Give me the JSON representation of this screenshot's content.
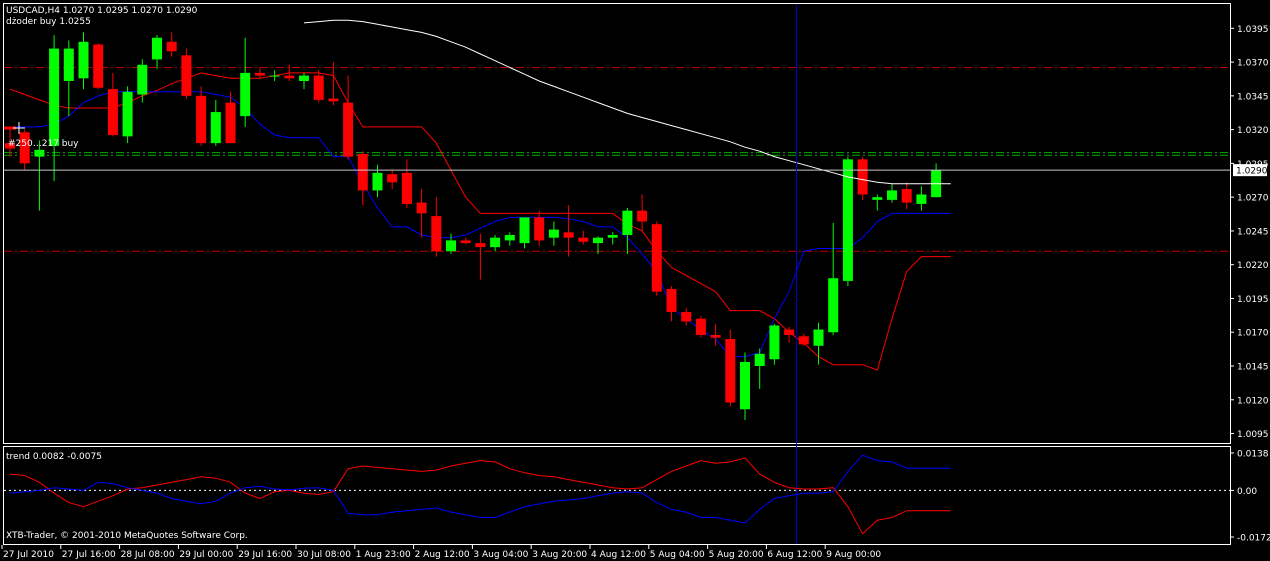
{
  "header": {
    "symbol_line": "USDCAD,H4 1.0270 1.0295 1.0270 1.0290",
    "order_line": "dżoder buy 1.0255",
    "trade_label": "#250…217 buy"
  },
  "indicator": {
    "title": "trend 0.0082 -0.0075",
    "scale_labels": [
      "0.0138",
      "0.00",
      "-0.0172"
    ],
    "levels": [
      0.0138,
      0.0,
      -0.0172
    ]
  },
  "copyright": "XTB-Trader, © 2001-2010 MetaQuotes Software Corp.",
  "colors": {
    "background": "#000000",
    "frame": "#ffffff",
    "bull": "#00ff00",
    "bear": "#ff0000",
    "red_line": "#ff0000",
    "blue_line": "#0000ff",
    "ma_line": "#ffffff",
    "green_level": "#00b000",
    "red_level": "#c00000",
    "vertical_line": "#0000cc"
  },
  "chart_data": {
    "type": "candlestick",
    "symbol": "USDCAD",
    "timeframe": "H4",
    "price_axis": {
      "ylim": [
        1.0088,
        1.0413
      ],
      "tick_labels": [
        "1.0395",
        "1.0370",
        "1.0345",
        "1.0320",
        "1.0295",
        "1.0270",
        "1.0245",
        "1.0220",
        "1.0195",
        "1.0170",
        "1.0145",
        "1.0120",
        "1.0095"
      ],
      "tick_values": [
        1.0395,
        1.037,
        1.0345,
        1.032,
        1.0295,
        1.027,
        1.0245,
        1.022,
        1.0195,
        1.017,
        1.0145,
        1.012,
        1.0095
      ],
      "current_price_label": "1.0290",
      "current_price": 1.029
    },
    "time_axis": {
      "labels": [
        "27 Jul 2010",
        "27 Jul 16:00",
        "28 Jul 08:00",
        "29 Jul 00:00",
        "29 Jul 16:00",
        "30 Jul 08:00",
        "1 Aug 23:00",
        "2 Aug 12:00",
        "3 Aug 04:00",
        "3 Aug 20:00",
        "4 Aug 12:00",
        "5 Aug 04:00",
        "5 Aug 20:00",
        "6 Aug 12:00",
        "9 Aug 00:00"
      ],
      "label_bar_index": [
        0,
        4,
        8,
        12,
        16,
        20,
        24,
        28,
        32,
        36,
        40,
        44,
        48,
        52,
        56
      ]
    },
    "horizontal_levels": [
      {
        "price": 1.0366,
        "color": "#c00000"
      },
      {
        "price": 1.0303,
        "color": "#00b000"
      },
      {
        "price": 1.0301,
        "color": "#00b000"
      },
      {
        "price": 1.023,
        "color": "#c00000"
      }
    ],
    "vertical_line_bar": 53.5,
    "candles": [
      {
        "o": 1.031,
        "h": 1.0322,
        "l": 1.03,
        "c": 1.0306
      },
      {
        "o": 1.0318,
        "h": 1.032,
        "l": 1.029,
        "c": 1.0295
      },
      {
        "o": 1.03,
        "h": 1.0312,
        "l": 1.026,
        "c": 1.0305
      },
      {
        "o": 1.0308,
        "h": 1.039,
        "l": 1.0282,
        "c": 1.038
      },
      {
        "o": 1.0356,
        "h": 1.0386,
        "l": 1.033,
        "c": 1.038
      },
      {
        "o": 1.0358,
        "h": 1.0392,
        "l": 1.035,
        "c": 1.0385
      },
      {
        "o": 1.0383,
        "h": 1.0384,
        "l": 1.035,
        "c": 1.0351
      },
      {
        "o": 1.035,
        "h": 1.0362,
        "l": 1.0315,
        "c": 1.0316
      },
      {
        "o": 1.0315,
        "h": 1.0352,
        "l": 1.031,
        "c": 1.0348
      },
      {
        "o": 1.0346,
        "h": 1.0372,
        "l": 1.034,
        "c": 1.0368
      },
      {
        "o": 1.0372,
        "h": 1.039,
        "l": 1.0365,
        "c": 1.0388
      },
      {
        "o": 1.0385,
        "h": 1.0392,
        "l": 1.0374,
        "c": 1.0378
      },
      {
        "o": 1.0375,
        "h": 1.038,
        "l": 1.0343,
        "c": 1.0345
      },
      {
        "o": 1.0345,
        "h": 1.0352,
        "l": 1.0308,
        "c": 1.031
      },
      {
        "o": 1.031,
        "h": 1.0342,
        "l": 1.0308,
        "c": 1.0333
      },
      {
        "o": 1.034,
        "h": 1.0348,
        "l": 1.031,
        "c": 1.031
      },
      {
        "o": 1.033,
        "h": 1.0388,
        "l": 1.0322,
        "c": 1.0362
      },
      {
        "o": 1.0362,
        "h": 1.0366,
        "l": 1.0358,
        "c": 1.036
      },
      {
        "o": 1.036,
        "h": 1.0364,
        "l": 1.0356,
        "c": 1.036
      },
      {
        "o": 1.036,
        "h": 1.0368,
        "l": 1.0356,
        "c": 1.0358
      },
      {
        "o": 1.0356,
        "h": 1.0362,
        "l": 1.035,
        "c": 1.036
      },
      {
        "o": 1.036,
        "h": 1.0364,
        "l": 1.034,
        "c": 1.0342
      },
      {
        "o": 1.0343,
        "h": 1.037,
        "l": 1.0338,
        "c": 1.0341
      },
      {
        "o": 1.034,
        "h": 1.036,
        "l": 1.0298,
        "c": 1.03
      },
      {
        "o": 1.0302,
        "h": 1.0304,
        "l": 1.0264,
        "c": 1.0275
      },
      {
        "o": 1.0275,
        "h": 1.0294,
        "l": 1.027,
        "c": 1.0288
      },
      {
        "o": 1.0287,
        "h": 1.029,
        "l": 1.0276,
        "c": 1.0281
      },
      {
        "o": 1.0288,
        "h": 1.0298,
        "l": 1.0262,
        "c": 1.0265
      },
      {
        "o": 1.0266,
        "h": 1.0276,
        "l": 1.024,
        "c": 1.0258
      },
      {
        "o": 1.0256,
        "h": 1.027,
        "l": 1.0226,
        "c": 1.023
      },
      {
        "o": 1.023,
        "h": 1.0243,
        "l": 1.0228,
        "c": 1.0238
      },
      {
        "o": 1.0238,
        "h": 1.024,
        "l": 1.0235,
        "c": 1.0236
      },
      {
        "o": 1.0236,
        "h": 1.0243,
        "l": 1.0209,
        "c": 1.0233
      },
      {
        "o": 1.0233,
        "h": 1.0242,
        "l": 1.023,
        "c": 1.024
      },
      {
        "o": 1.0238,
        "h": 1.0244,
        "l": 1.0234,
        "c": 1.0242
      },
      {
        "o": 1.0236,
        "h": 1.0255,
        "l": 1.0232,
        "c": 1.0255
      },
      {
        "o": 1.0255,
        "h": 1.026,
        "l": 1.0234,
        "c": 1.0238
      },
      {
        "o": 1.024,
        "h": 1.0252,
        "l": 1.0234,
        "c": 1.0246
      },
      {
        "o": 1.0244,
        "h": 1.0264,
        "l": 1.0226,
        "c": 1.024
      },
      {
        "o": 1.024,
        "h": 1.0245,
        "l": 1.0235,
        "c": 1.0237
      },
      {
        "o": 1.0236,
        "h": 1.0241,
        "l": 1.0228,
        "c": 1.024
      },
      {
        "o": 1.024,
        "h": 1.0244,
        "l": 1.0235,
        "c": 1.0242
      },
      {
        "o": 1.0242,
        "h": 1.0262,
        "l": 1.0228,
        "c": 1.026
      },
      {
        "o": 1.026,
        "h": 1.0272,
        "l": 1.0245,
        "c": 1.0252
      },
      {
        "o": 1.025,
        "h": 1.0252,
        "l": 1.0197,
        "c": 1.02
      },
      {
        "o": 1.0202,
        "h": 1.0204,
        "l": 1.0178,
        "c": 1.0185
      },
      {
        "o": 1.0185,
        "h": 1.0188,
        "l": 1.0175,
        "c": 1.0178
      },
      {
        "o": 1.018,
        "h": 1.0182,
        "l": 1.0166,
        "c": 1.0168
      },
      {
        "o": 1.0168,
        "h": 1.0176,
        "l": 1.016,
        "c": 1.0166
      },
      {
        "o": 1.0165,
        "h": 1.0172,
        "l": 1.0115,
        "c": 1.0118
      },
      {
        "o": 1.0113,
        "h": 1.0155,
        "l": 1.0105,
        "c": 1.0148
      },
      {
        "o": 1.0145,
        "h": 1.0158,
        "l": 1.0128,
        "c": 1.0154
      },
      {
        "o": 1.015,
        "h": 1.0176,
        "l": 1.0146,
        "c": 1.0175
      },
      {
        "o": 1.0172,
        "h": 1.0174,
        "l": 1.0162,
        "c": 1.0168
      },
      {
        "o": 1.0167,
        "h": 1.0169,
        "l": 1.016,
        "c": 1.0161
      },
      {
        "o": 1.016,
        "h": 1.0177,
        "l": 1.0146,
        "c": 1.0172
      },
      {
        "o": 1.017,
        "h": 1.0251,
        "l": 1.0168,
        "c": 1.021
      },
      {
        "o": 1.0208,
        "h": 1.03,
        "l": 1.0204,
        "c": 1.0298
      },
      {
        "o": 1.0298,
        "h": 1.03,
        "l": 1.0268,
        "c": 1.0272
      },
      {
        "o": 1.0268,
        "h": 1.0272,
        "l": 1.026,
        "c": 1.027
      },
      {
        "o": 1.0268,
        "h": 1.028,
        "l": 1.0266,
        "c": 1.0275
      },
      {
        "o": 1.0276,
        "h": 1.0281,
        "l": 1.0261,
        "c": 1.0266
      },
      {
        "o": 1.0265,
        "h": 1.0278,
        "l": 1.026,
        "c": 1.0272
      },
      {
        "o": 1.027,
        "h": 1.0295,
        "l": 1.027,
        "c": 1.029
      }
    ],
    "envelope_upper": [
      1.035,
      1.0346,
      1.0342,
      1.0338,
      1.0336,
      1.0336,
      1.0336,
      1.0336,
      1.034,
      1.0345,
      1.0349,
      1.0354,
      1.0358,
      1.0362,
      1.036,
      1.0358,
      1.0358,
      1.0358,
      1.036,
      1.0362,
      1.0362,
      1.0362,
      1.036,
      1.034,
      1.0322,
      1.0322,
      1.0322,
      1.0322,
      1.0322,
      1.031,
      1.029,
      1.027,
      1.0258,
      1.0258,
      1.0258,
      1.0258,
      1.0258,
      1.0258,
      1.0258,
      1.0258,
      1.0258,
      1.0258,
      1.025,
      1.0245,
      1.023,
      1.0218,
      1.0212,
      1.0206,
      1.02,
      1.0186,
      1.0186,
      1.0186,
      1.018,
      1.017,
      1.0162,
      1.0152,
      1.0146,
      1.0146,
      1.0146,
      1.0142,
      1.018,
      1.0215,
      1.0226,
      1.0226,
      1.0226
    ],
    "envelope_lower": [
      1.0322,
      1.0322,
      1.0322,
      1.0324,
      1.033,
      1.034,
      1.0345,
      1.0348,
      1.0348,
      1.0348,
      1.0348,
      1.0348,
      1.0348,
      1.0348,
      1.0346,
      1.0344,
      1.0336,
      1.0324,
      1.0316,
      1.0314,
      1.0314,
      1.0314,
      1.03,
      1.03,
      1.028,
      1.0262,
      1.0248,
      1.0248,
      1.0242,
      1.024,
      1.024,
      1.0242,
      1.0247,
      1.0252,
      1.0255,
      1.0255,
      1.0255,
      1.0255,
      1.0254,
      1.0252,
      1.0248,
      1.0248,
      1.024,
      1.0228,
      1.0215,
      1.0188,
      1.018,
      1.0172,
      1.0165,
      1.0152,
      1.0152,
      1.0155,
      1.018,
      1.02,
      1.023,
      1.0232,
      1.0232,
      1.0232,
      1.024,
      1.0252,
      1.0258,
      1.0258,
      1.0258,
      1.0258,
      1.0258
    ],
    "moving_average": [
      1.0399,
      1.04,
      1.0401,
      1.0401,
      1.04,
      1.0398,
      1.0396,
      1.0394,
      1.0392,
      1.0389,
      1.0385,
      1.0381,
      1.0376,
      1.0371,
      1.0366,
      1.0361,
      1.0356,
      1.0352,
      1.0348,
      1.0344,
      1.034,
      1.0336,
      1.0332,
      1.0329,
      1.0326,
      1.0323,
      1.032,
      1.0317,
      1.0314,
      1.0311,
      1.0307,
      1.0304,
      1.03,
      1.0297,
      1.0294,
      1.0291,
      1.0288,
      1.0285,
      1.0283,
      1.0281,
      1.028,
      1.028,
      1.028,
      1.028,
      1.028
    ],
    "moving_average_start_bar": 20,
    "trend_red": [
      0.006,
      0.0055,
      0.003,
      -0.001,
      -0.0045,
      -0.006,
      -0.004,
      -0.002,
      0.0005,
      0.001,
      0.002,
      0.003,
      0.004,
      0.005,
      0.0045,
      0.003,
      -0.001,
      -0.003,
      -0.0005,
      0.0,
      -0.001,
      -0.0015,
      -0.0005,
      0.008,
      0.009,
      0.0085,
      0.008,
      0.0075,
      0.007,
      0.0075,
      0.009,
      0.01,
      0.011,
      0.0105,
      0.008,
      0.0065,
      0.0055,
      0.005,
      0.004,
      0.003,
      0.002,
      0.001,
      0.0005,
      0.001,
      0.004,
      0.007,
      0.009,
      0.011,
      0.01,
      0.0105,
      0.012,
      0.006,
      0.003,
      0.001,
      0.0005,
      0.0005,
      0.001,
      -0.006,
      -0.016,
      -0.011,
      -0.01,
      -0.0075,
      -0.0075,
      -0.0075,
      -0.0075
    ],
    "trend_blue": [
      -0.001,
      -0.0005,
      0.0,
      0.001,
      0.0005,
      0.0,
      0.003,
      0.0025,
      0.001,
      0.0,
      -0.001,
      -0.003,
      -0.004,
      -0.005,
      -0.004,
      -0.001,
      0.001,
      0.0015,
      0.0005,
      0.0002,
      0.0008,
      0.001,
      0.0,
      -0.0085,
      -0.009,
      -0.009,
      -0.008,
      -0.0075,
      -0.007,
      -0.0065,
      -0.008,
      -0.009,
      -0.01,
      -0.01,
      -0.008,
      -0.006,
      -0.005,
      -0.004,
      -0.0035,
      -0.003,
      -0.002,
      -0.001,
      -0.0005,
      -0.001,
      -0.0045,
      -0.007,
      -0.008,
      -0.01,
      -0.01,
      -0.011,
      -0.012,
      -0.007,
      -0.003,
      -0.002,
      -0.001,
      -0.001,
      -0.0005,
      0.007,
      0.013,
      0.011,
      0.0105,
      0.0082,
      0.0082,
      0.0082,
      0.0082
    ]
  }
}
